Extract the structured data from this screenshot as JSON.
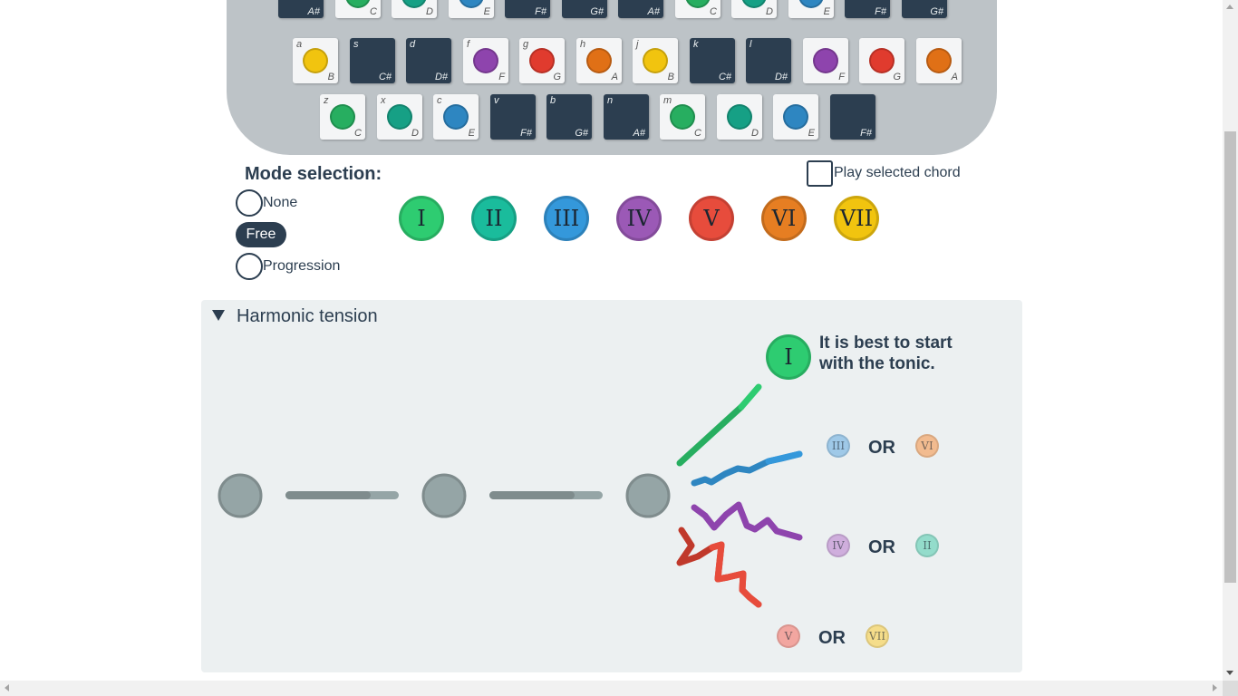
{
  "keyboard": {
    "rows": [
      [
        {
          "hot": "",
          "note": "A#",
          "dark": true
        },
        {
          "hot": "",
          "note": "C",
          "color": "#27ae60"
        },
        {
          "hot": "",
          "note": "D",
          "color": "#16a085"
        },
        {
          "hot": "",
          "note": "E",
          "color": "#2e86c1"
        },
        {
          "hot": "",
          "note": "F#",
          "dark": true
        },
        {
          "hot": "",
          "note": "G#",
          "dark": true
        },
        {
          "hot": "",
          "note": "A#",
          "dark": true
        },
        {
          "hot": "",
          "note": "C",
          "color": "#27ae60"
        },
        {
          "hot": "",
          "note": "D",
          "color": "#16a085"
        },
        {
          "hot": "",
          "note": "E",
          "color": "#2e86c1"
        },
        {
          "hot": "",
          "note": "F#",
          "dark": true
        },
        {
          "hot": "",
          "note": "G#",
          "dark": true
        }
      ],
      [
        {
          "hot": "a",
          "note": "B",
          "color": "#f1c40f"
        },
        {
          "hot": "s",
          "note": "C#",
          "dark": true
        },
        {
          "hot": "d",
          "note": "D#",
          "dark": true
        },
        {
          "hot": "f",
          "note": "F",
          "color": "#8e44ad"
        },
        {
          "hot": "g",
          "note": "G",
          "color": "#e03b2e"
        },
        {
          "hot": "h",
          "note": "A",
          "color": "#e07016"
        },
        {
          "hot": "j",
          "note": "B",
          "color": "#f1c40f"
        },
        {
          "hot": "k",
          "note": "C#",
          "dark": true
        },
        {
          "hot": "l",
          "note": "D#",
          "dark": true
        },
        {
          "hot": "",
          "note": "F",
          "color": "#8e44ad"
        },
        {
          "hot": "",
          "note": "G",
          "color": "#e03b2e"
        },
        {
          "hot": "",
          "note": "A",
          "color": "#e07016"
        }
      ],
      [
        {
          "hot": "z",
          "note": "C",
          "color": "#27ae60"
        },
        {
          "hot": "x",
          "note": "D",
          "color": "#16a085"
        },
        {
          "hot": "c",
          "note": "E",
          "color": "#2e86c1"
        },
        {
          "hot": "v",
          "note": "F#",
          "dark": true
        },
        {
          "hot": "b",
          "note": "G#",
          "dark": true
        },
        {
          "hot": "n",
          "note": "A#",
          "dark": true
        },
        {
          "hot": "m",
          "note": "C",
          "color": "#27ae60"
        },
        {
          "hot": "",
          "note": "D",
          "color": "#16a085"
        },
        {
          "hot": "",
          "note": "E",
          "color": "#2e86c1"
        },
        {
          "hot": "",
          "note": "F#",
          "dark": true
        }
      ]
    ]
  },
  "mode": {
    "title": "Mode selection:",
    "options": [
      "None",
      "Free",
      "Progression"
    ],
    "selected": "Free"
  },
  "play_selected_chord": {
    "label": "Play selected chord",
    "checked": false
  },
  "chords": [
    {
      "label": "I",
      "color": "#2ecc71"
    },
    {
      "label": "II",
      "color": "#1abc9c"
    },
    {
      "label": "III",
      "color": "#3498db"
    },
    {
      "label": "IV",
      "color": "#9b59b6"
    },
    {
      "label": "V",
      "color": "#e74c3c"
    },
    {
      "label": "VI",
      "color": "#e67e22"
    },
    {
      "label": "VII",
      "color": "#f1c40f"
    }
  ],
  "tension": {
    "title": "Harmonic tension",
    "tip_chord": "I",
    "tip_text": "It is best to start with the tonic.",
    "or_label": "OR",
    "pairs": [
      {
        "a": "III",
        "b": "VI"
      },
      {
        "a": "IV",
        "b": "II"
      },
      {
        "a": "V",
        "b": "VII"
      }
    ],
    "progress": [
      0.75,
      0.75
    ]
  },
  "colors": {
    "dark": "#2c3e50",
    "keyboard_bg": "#bdc3c7",
    "panel_bg": "#ecf0f1",
    "slot_gray": "#95a5a6"
  }
}
